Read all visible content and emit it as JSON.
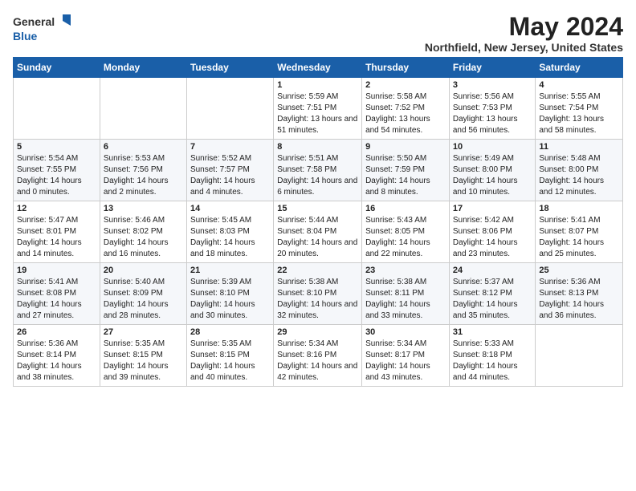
{
  "logo": {
    "general": "General",
    "blue": "Blue"
  },
  "title": "May 2024",
  "location": "Northfield, New Jersey, United States",
  "weekdays": [
    "Sunday",
    "Monday",
    "Tuesday",
    "Wednesday",
    "Thursday",
    "Friday",
    "Saturday"
  ],
  "weeks": [
    [
      {
        "day": null
      },
      {
        "day": null
      },
      {
        "day": null
      },
      {
        "day": "1",
        "sunrise": "5:59 AM",
        "sunset": "7:51 PM",
        "daylight": "13 hours and 51 minutes."
      },
      {
        "day": "2",
        "sunrise": "5:58 AM",
        "sunset": "7:52 PM",
        "daylight": "13 hours and 54 minutes."
      },
      {
        "day": "3",
        "sunrise": "5:56 AM",
        "sunset": "7:53 PM",
        "daylight": "13 hours and 56 minutes."
      },
      {
        "day": "4",
        "sunrise": "5:55 AM",
        "sunset": "7:54 PM",
        "daylight": "13 hours and 58 minutes."
      }
    ],
    [
      {
        "day": "5",
        "sunrise": "5:54 AM",
        "sunset": "7:55 PM",
        "daylight": "14 hours and 0 minutes."
      },
      {
        "day": "6",
        "sunrise": "5:53 AM",
        "sunset": "7:56 PM",
        "daylight": "14 hours and 2 minutes."
      },
      {
        "day": "7",
        "sunrise": "5:52 AM",
        "sunset": "7:57 PM",
        "daylight": "14 hours and 4 minutes."
      },
      {
        "day": "8",
        "sunrise": "5:51 AM",
        "sunset": "7:58 PM",
        "daylight": "14 hours and 6 minutes."
      },
      {
        "day": "9",
        "sunrise": "5:50 AM",
        "sunset": "7:59 PM",
        "daylight": "14 hours and 8 minutes."
      },
      {
        "day": "10",
        "sunrise": "5:49 AM",
        "sunset": "8:00 PM",
        "daylight": "14 hours and 10 minutes."
      },
      {
        "day": "11",
        "sunrise": "5:48 AM",
        "sunset": "8:00 PM",
        "daylight": "14 hours and 12 minutes."
      }
    ],
    [
      {
        "day": "12",
        "sunrise": "5:47 AM",
        "sunset": "8:01 PM",
        "daylight": "14 hours and 14 minutes."
      },
      {
        "day": "13",
        "sunrise": "5:46 AM",
        "sunset": "8:02 PM",
        "daylight": "14 hours and 16 minutes."
      },
      {
        "day": "14",
        "sunrise": "5:45 AM",
        "sunset": "8:03 PM",
        "daylight": "14 hours and 18 minutes."
      },
      {
        "day": "15",
        "sunrise": "5:44 AM",
        "sunset": "8:04 PM",
        "daylight": "14 hours and 20 minutes."
      },
      {
        "day": "16",
        "sunrise": "5:43 AM",
        "sunset": "8:05 PM",
        "daylight": "14 hours and 22 minutes."
      },
      {
        "day": "17",
        "sunrise": "5:42 AM",
        "sunset": "8:06 PM",
        "daylight": "14 hours and 23 minutes."
      },
      {
        "day": "18",
        "sunrise": "5:41 AM",
        "sunset": "8:07 PM",
        "daylight": "14 hours and 25 minutes."
      }
    ],
    [
      {
        "day": "19",
        "sunrise": "5:41 AM",
        "sunset": "8:08 PM",
        "daylight": "14 hours and 27 minutes."
      },
      {
        "day": "20",
        "sunrise": "5:40 AM",
        "sunset": "8:09 PM",
        "daylight": "14 hours and 28 minutes."
      },
      {
        "day": "21",
        "sunrise": "5:39 AM",
        "sunset": "8:10 PM",
        "daylight": "14 hours and 30 minutes."
      },
      {
        "day": "22",
        "sunrise": "5:38 AM",
        "sunset": "8:10 PM",
        "daylight": "14 hours and 32 minutes."
      },
      {
        "day": "23",
        "sunrise": "5:38 AM",
        "sunset": "8:11 PM",
        "daylight": "14 hours and 33 minutes."
      },
      {
        "day": "24",
        "sunrise": "5:37 AM",
        "sunset": "8:12 PM",
        "daylight": "14 hours and 35 minutes."
      },
      {
        "day": "25",
        "sunrise": "5:36 AM",
        "sunset": "8:13 PM",
        "daylight": "14 hours and 36 minutes."
      }
    ],
    [
      {
        "day": "26",
        "sunrise": "5:36 AM",
        "sunset": "8:14 PM",
        "daylight": "14 hours and 38 minutes."
      },
      {
        "day": "27",
        "sunrise": "5:35 AM",
        "sunset": "8:15 PM",
        "daylight": "14 hours and 39 minutes."
      },
      {
        "day": "28",
        "sunrise": "5:35 AM",
        "sunset": "8:15 PM",
        "daylight": "14 hours and 40 minutes."
      },
      {
        "day": "29",
        "sunrise": "5:34 AM",
        "sunset": "8:16 PM",
        "daylight": "14 hours and 42 minutes."
      },
      {
        "day": "30",
        "sunrise": "5:34 AM",
        "sunset": "8:17 PM",
        "daylight": "14 hours and 43 minutes."
      },
      {
        "day": "31",
        "sunrise": "5:33 AM",
        "sunset": "8:18 PM",
        "daylight": "14 hours and 44 minutes."
      },
      {
        "day": null
      }
    ]
  ],
  "labels": {
    "sunrise": "Sunrise:",
    "sunset": "Sunset:",
    "daylight": "Daylight:"
  },
  "colors": {
    "header_bg": "#1a5fa8",
    "logo_blue": "#1a5fa8"
  }
}
